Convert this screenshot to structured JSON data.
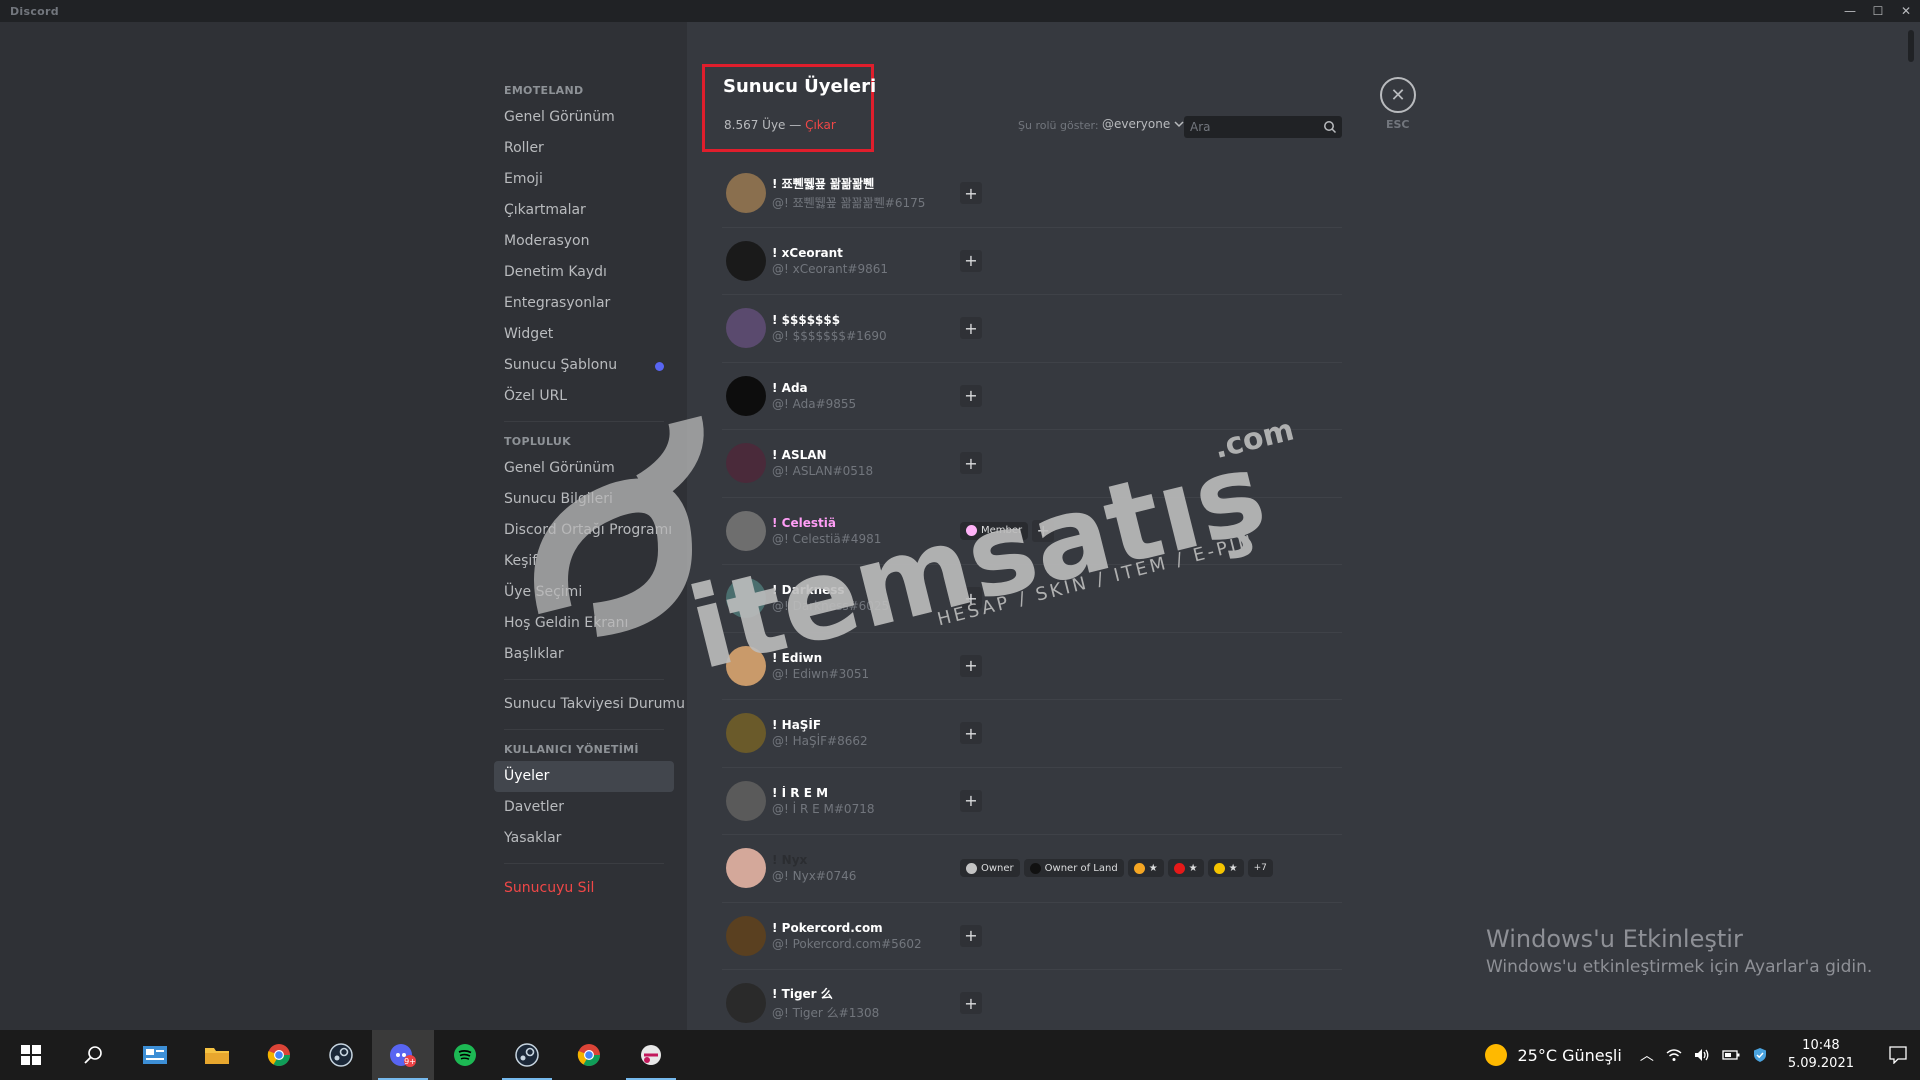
{
  "window": {
    "title": "Discord",
    "controls": [
      "—",
      "☐",
      "✕"
    ]
  },
  "sidebar": {
    "sections": [
      {
        "header": "EMOTELAND",
        "items": [
          {
            "label": "Genel Görünüm"
          },
          {
            "label": "Roller"
          },
          {
            "label": "Emoji"
          },
          {
            "label": "Çıkartmalar"
          },
          {
            "label": "Moderasyon"
          },
          {
            "label": "Denetim Kaydı"
          },
          {
            "label": "Entegrasyonlar"
          },
          {
            "label": "Widget"
          },
          {
            "label": "Sunucu Şablonu"
          },
          {
            "label": "Özel URL"
          }
        ]
      },
      {
        "header": "TOPLULUK",
        "items": [
          {
            "label": "Genel Görünüm"
          },
          {
            "label": "Sunucu Bilgileri"
          },
          {
            "label": "Discord Ortağı Programı"
          },
          {
            "label": "Keşif"
          },
          {
            "label": "Üye Seçimi"
          },
          {
            "label": "Hoş Geldin Ekranı"
          },
          {
            "label": "Başlıklar"
          }
        ]
      },
      {
        "header": "",
        "items": [
          {
            "label": "Sunucu Takviyesi Durumu"
          }
        ]
      },
      {
        "header": "KULLANICI YÖNETİMİ",
        "items": [
          {
            "label": "Üyeler"
          },
          {
            "label": "Davetler"
          },
          {
            "label": "Yasaklar"
          }
        ]
      },
      {
        "header": "",
        "items": [
          {
            "label": "Sunucuyu Sil"
          }
        ]
      }
    ]
  },
  "header": {
    "title": "Sunucu Üyeleri",
    "count": "8.567 Üye — ",
    "prune": "Çıkar",
    "filter_label": "Şu rolü göster:",
    "role_filter": "@everyone",
    "search_placeholder": "Ara",
    "esc": "ESC"
  },
  "members": [
    {
      "name": "! 쬬쀈뛣꾶 꽒꽒꽒쀈",
      "tag": "@! 쬬쀈뛣꾶 꽒꽒꽒쀈#6175",
      "avatar_color": "#8a6f4e"
    },
    {
      "name": "! xCeorant",
      "tag": "@! xCeorant#9861",
      "avatar_color": "#1a1a1a"
    },
    {
      "name": "! $$$$$$$",
      "tag": "@! $$$$$$$#1690",
      "avatar_color": "#5a4a6e"
    },
    {
      "name": "! Ada",
      "tag": "@! Ada#9855",
      "avatar_color": "#0d0d0d"
    },
    {
      "name": "! ASLAN",
      "tag": "@! ASLAN#0518",
      "avatar_color": "#4a2a3a"
    },
    {
      "name": "! Celestiä",
      "tag": "@! Celestiä#4981",
      "avatar_color": "#6e6e6e",
      "name_color": "#ff9ef6",
      "roles": [
        {
          "name": "Member",
          "color": "#ffb3f7"
        }
      ]
    },
    {
      "name": "! Darkness",
      "tag": "@! Darkness#6025",
      "avatar_color": "#4a6e6e"
    },
    {
      "name": "! Ediwn",
      "tag": "@! Ediwn#3051",
      "avatar_color": "#c99a6a"
    },
    {
      "name": "! HaŞİF",
      "tag": "@! HaŞİF#8662",
      "avatar_color": "#6a5a2a"
    },
    {
      "name": "! İ R E M",
      "tag": "@! İ R E M#0718",
      "avatar_color": "#5a5a5a"
    },
    {
      "name": "! Nyx",
      "tag": "@! Nyx#0746",
      "avatar_color": "#d4a89a",
      "name_color": "#2b2d31",
      "roles": [
        {
          "name": "Owner",
          "color": "#c4c4c4"
        },
        {
          "name": "Owner of Land",
          "color": "#111111"
        },
        {
          "name": "★",
          "color": "#f5a623"
        },
        {
          "name": "★",
          "color": "#e61919"
        },
        {
          "name": "★",
          "color": "#f5c400"
        }
      ],
      "more": "+7"
    },
    {
      "name": "! Pokercord.com",
      "tag": "@! Pokercord.com#5602",
      "avatar_color": "#5a4020"
    },
    {
      "name": "! Tiger 么",
      "tag": "@! Tiger 么#1308",
      "avatar_color": "#2a2a2a"
    }
  ],
  "watermark": {
    "brand": "itemsatış",
    "domain": ".com",
    "tagline": "HESAP / SKIN / ITEM / E-PIN"
  },
  "activation": {
    "line1": "Windows'u Etkinleştir",
    "line2": "Windows'u etkinleştirmek için Ayarlar'a gidin."
  },
  "taskbar": {
    "weather": "25°C  Güneşli",
    "time": "10:48",
    "date": "5.09.2021",
    "apps": [
      "start-icon",
      "search-icon",
      "news-icon",
      "file-explorer-icon",
      "chrome-icon",
      "steam-icon",
      "discord-icon",
      "spotify-icon",
      "steam-icon",
      "chrome-icon",
      "snip-icon"
    ]
  }
}
